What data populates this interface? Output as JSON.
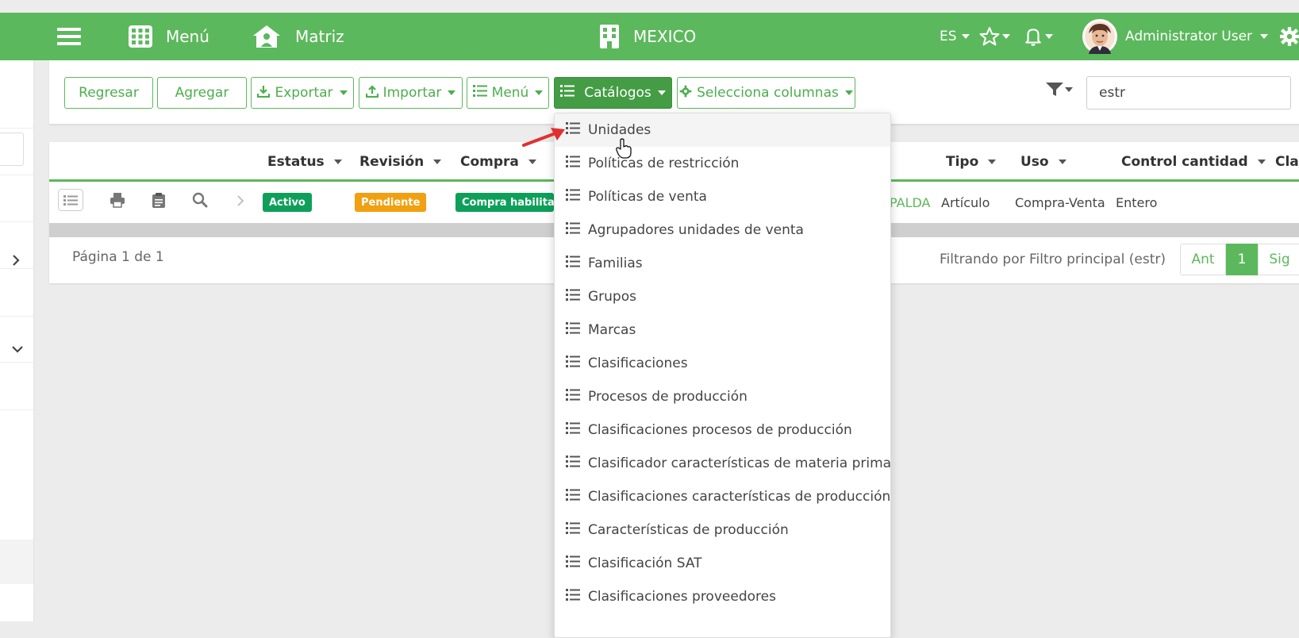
{
  "topbar": {
    "menu_label": "Menú",
    "home_label": "Matriz",
    "company": "MEXICO",
    "lang": "ES",
    "user": "Administrator User",
    "color": "#5cb85c"
  },
  "toolbar": {
    "back": "Regresar",
    "add": "Agregar",
    "export": "Exportar",
    "import": "Importar",
    "menu": "Menú",
    "catalogs": "Catálogos",
    "columns": "Selecciona columnas",
    "search_value": "estr"
  },
  "table": {
    "headers": [
      "Estatus",
      "Revisión",
      "Compra",
      "Tipo",
      "Uso",
      "Control cantidad",
      "Clas"
    ],
    "row": {
      "estatus": "Activo",
      "revision": "Pendiente",
      "compra": "Compra habilitado",
      "partial": "PALDA",
      "tipo": "Artículo",
      "uso": "Compra-Venta",
      "control": "Entero"
    }
  },
  "pager": {
    "page_info": "Página 1 de 1",
    "filter_info": "Filtrando por Filtro principal (estr)",
    "prev": "Ant",
    "current": "1",
    "next": "Sig"
  },
  "dropdown": {
    "items": [
      "Unidades",
      "Políticas de restricción",
      "Políticas de venta",
      "Agrupadores unidades de venta",
      "Familias",
      "Grupos",
      "Marcas",
      "Clasificaciones",
      "Procesos de producción",
      "Clasificaciones procesos de producción",
      "Clasificador características de materia prima",
      "Clasificaciones características de producción",
      "Características de producción",
      "Clasificación SAT",
      "Clasificaciones proveedores"
    ]
  },
  "colors": {
    "badge_active": "#0ea05a",
    "badge_pending": "#f0a010",
    "accent_dark": "#449d44"
  }
}
